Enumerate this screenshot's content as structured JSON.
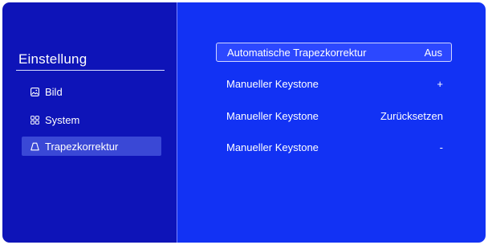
{
  "sidebar": {
    "title": "Einstellung",
    "items": [
      {
        "label": "Bild",
        "icon": "image-icon"
      },
      {
        "label": "System",
        "icon": "grid-icon"
      },
      {
        "label": "Trapezkorrektur",
        "icon": "trapezoid-icon",
        "active": true
      }
    ]
  },
  "settings": {
    "rows": [
      {
        "label": "Automatische Trapezkorrektur",
        "value": "Aus",
        "selected": true
      },
      {
        "label": "Manueller Keystone",
        "value": "+"
      },
      {
        "label": "Manueller Keystone",
        "value": "Zurücksetzen"
      },
      {
        "label": "Manueller Keystone",
        "value": "-"
      }
    ]
  },
  "colors": {
    "sidebar_bg": "#0e14b8",
    "content_bg": "#1232f4",
    "active_item_bg": "#3a48d6",
    "selected_row_border": "#d0d6ff"
  }
}
